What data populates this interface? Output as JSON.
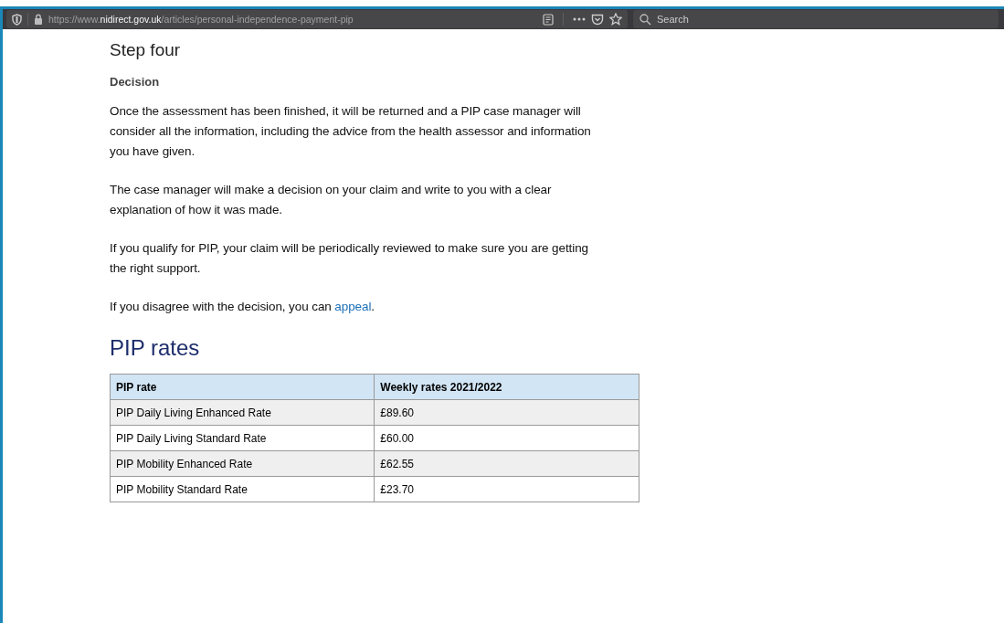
{
  "browser": {
    "url": "https://www.**nidirect.gov.uk**/articles/personal-independence-payment-pip",
    "search": {
      "placeholder": "Search"
    }
  },
  "article": {
    "step_heading": "Step four",
    "subheading": "Decision",
    "paragraphs": [
      {
        "text": "Once the assessment has been finished, it will be returned and a PIP case manager will consider all the information, including the advice from the health assessor and information you have given."
      },
      {
        "text": "The case manager will make a decision on your claim and write to you with a clear explanation of how it was made."
      },
      {
        "text": "If you qualify for PIP, your claim will be periodically reviewed to make sure you are getting the right support."
      },
      {
        "text": "If you disagree with the decision, you can ",
        "link": "appeal",
        "after": "."
      }
    ],
    "rates_heading": "PIP rates",
    "table": {
      "columns": [
        "PIP rate",
        "Weekly rates 2021/2022"
      ],
      "rows": [
        [
          "PIP Daily Living Enhanced Rate",
          "£89.60"
        ],
        [
          "PIP Daily Living Standard Rate",
          "£60.00"
        ],
        [
          "PIP Mobility Enhanced Rate",
          "£62.55"
        ],
        [
          "PIP Mobility Standard Rate",
          "£23.70"
        ]
      ]
    }
  }
}
